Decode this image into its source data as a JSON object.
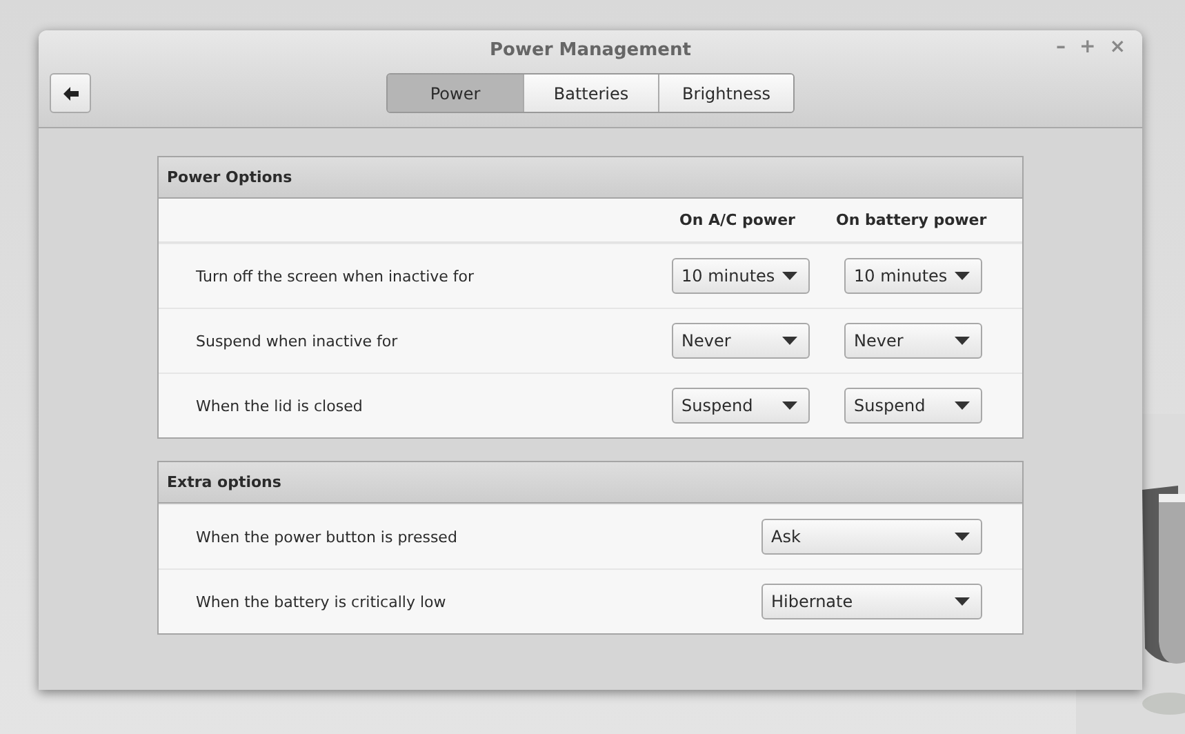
{
  "window": {
    "title": "Power Management",
    "controls": [
      "–",
      "+",
      "×"
    ]
  },
  "tabs": [
    {
      "label": "Power",
      "selected": true
    },
    {
      "label": "Batteries",
      "selected": false
    },
    {
      "label": "Brightness",
      "selected": false
    }
  ],
  "sections": [
    {
      "title": "Power Options",
      "columns": [
        "On A/C power",
        "On battery power"
      ],
      "rows": [
        {
          "label": "Turn off the screen when inactive for",
          "values": [
            "10 minutes",
            "10 minutes"
          ]
        },
        {
          "label": "Suspend when inactive for",
          "values": [
            "Never",
            "Never"
          ]
        },
        {
          "label": "When the lid is closed",
          "values": [
            "Suspend",
            "Suspend"
          ]
        }
      ]
    },
    {
      "title": "Extra options",
      "rows": [
        {
          "label": "When the power button is pressed",
          "values": [
            "Ask"
          ]
        },
        {
          "label": "When the battery is critically low",
          "values": [
            "Hibernate"
          ]
        }
      ]
    }
  ]
}
